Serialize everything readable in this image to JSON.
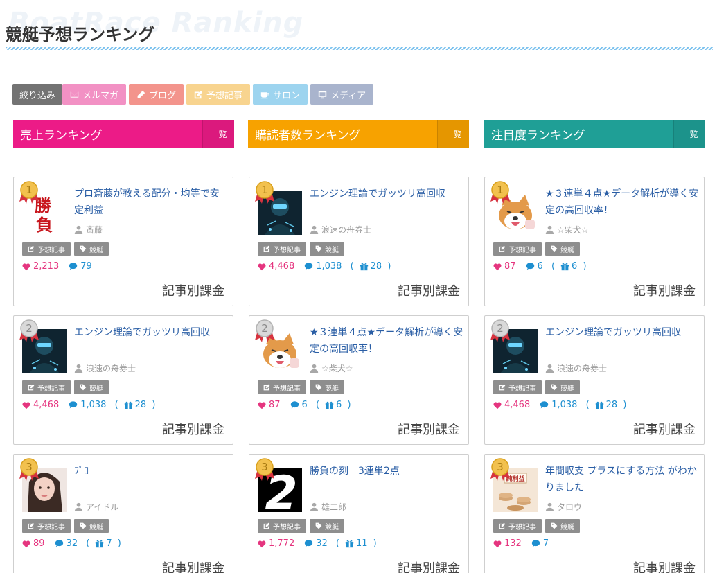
{
  "watermark": "BoatRace Ranking",
  "page_title": "競艇予想ランキング",
  "filters": [
    {
      "label": "絞り込み",
      "icon": "none"
    },
    {
      "label": "メルマガ",
      "icon": "envelope-icon"
    },
    {
      "label": "ブログ",
      "icon": "pencil-icon"
    },
    {
      "label": "予想記事",
      "icon": "edit-icon"
    },
    {
      "label": "サロン",
      "icon": "coffee-icon"
    },
    {
      "label": "メディア",
      "icon": "monitor-icon"
    }
  ],
  "columns": [
    {
      "title": "売上ランキング",
      "more_label": "一覧",
      "color": "#ec1b87",
      "cards": [
        {
          "rank": "1",
          "title": "プロ斎藤が教える配分・均等で安定利益",
          "author": "斎藤",
          "tags": [
            "予想記事",
            "競艇"
          ],
          "likes": "2,213",
          "comments": "79",
          "gifts": "",
          "price": "記事別課金",
          "thumb": "shoubu"
        },
        {
          "rank": "2",
          "title": "エンジン理論でガッツリ高回収",
          "author": "浪速の舟券士",
          "tags": [
            "予想記事",
            "競艇"
          ],
          "likes": "4,468",
          "comments": "1,038",
          "gifts": "28",
          "price": "記事別課金",
          "thumb": "hacker"
        },
        {
          "rank": "3",
          "title": "ﾌﾟﾛ",
          "author": "アイドル",
          "tags": [
            "予想記事",
            "競艇"
          ],
          "likes": "89",
          "comments": "32",
          "gifts": "7",
          "price": "記事別課金",
          "thumb": "woman"
        }
      ]
    },
    {
      "title": "購読者数ランキング",
      "more_label": "一覧",
      "color": "#f7a200",
      "cards": [
        {
          "rank": "1",
          "title": "エンジン理論でガッツリ高回収",
          "author": "浪速の舟券士",
          "tags": [
            "予想記事",
            "競艇"
          ],
          "likes": "4,468",
          "comments": "1,038",
          "gifts": "28",
          "price": "記事別課金",
          "thumb": "hacker"
        },
        {
          "rank": "2",
          "title": "★３連単４点★データ解析が導く安定の高回収率！",
          "author": "☆柴犬☆",
          "tags": [
            "予想記事",
            "競艇"
          ],
          "likes": "87",
          "comments": "6",
          "gifts": "6",
          "price": "記事別課金",
          "thumb": "dog"
        },
        {
          "rank": "3",
          "title": "勝負の刻　3連単2点",
          "author": "雄二郎",
          "tags": [
            "予想記事",
            "競艇"
          ],
          "likes": "1,772",
          "comments": "32",
          "gifts": "11",
          "price": "記事別課金",
          "thumb": "two"
        }
      ]
    },
    {
      "title": "注目度ランキング",
      "more_label": "一覧",
      "color": "#1f9f96",
      "cards": [
        {
          "rank": "1",
          "title": "★３連単４点★データ解析が導く安定の高回収率！",
          "author": "☆柴犬☆",
          "tags": [
            "予想記事",
            "競艇"
          ],
          "likes": "87",
          "comments": "6",
          "gifts": "6",
          "price": "記事別課金",
          "thumb": "dog"
        },
        {
          "rank": "2",
          "title": "エンジン理論でガッツリ高回収",
          "author": "浪速の舟券士",
          "tags": [
            "予想記事",
            "競艇"
          ],
          "likes": "4,468",
          "comments": "1,038",
          "gifts": "28",
          "price": "記事別課金",
          "thumb": "hacker"
        },
        {
          "rank": "3",
          "title": "年間収支 プラスにする方法 がわかりました",
          "author": "タロウ",
          "tags": [
            "予想記事",
            "競艇"
          ],
          "likes": "132",
          "comments": "7",
          "gifts": "",
          "price": "記事別課金",
          "thumb": "coins"
        }
      ]
    }
  ],
  "thumb_text": {
    "shoubu_1": "勝",
    "shoubu_2": "負",
    "two": "2",
    "coins": "純利益"
  }
}
